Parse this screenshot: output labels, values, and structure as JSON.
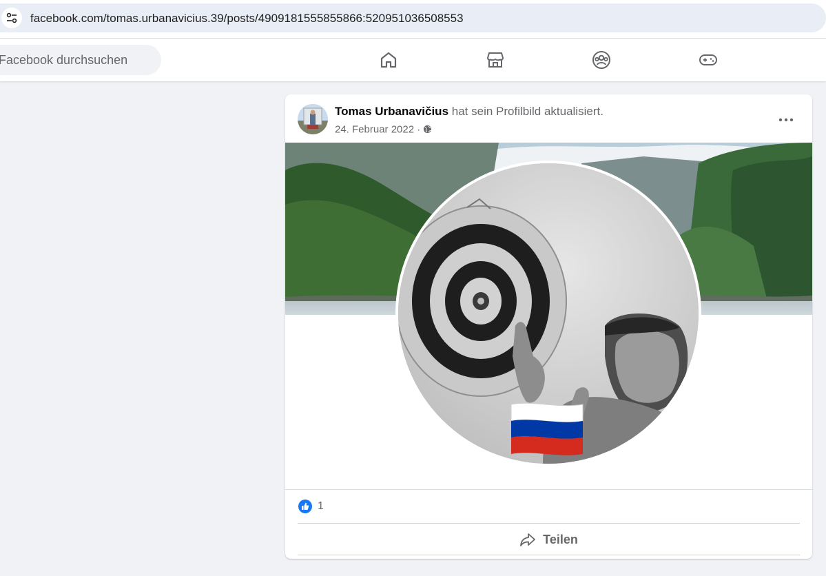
{
  "browser": {
    "url": "facebook.com/tomas.urbanavicius.39/posts/4909181555855866:520951036508553",
    "site_info_icon": "tune-icon"
  },
  "header": {
    "search_placeholder": "Facebook durchsuchen",
    "nav": [
      {
        "name": "home-icon"
      },
      {
        "name": "marketplace-icon"
      },
      {
        "name": "groups-icon"
      },
      {
        "name": "gaming-icon"
      }
    ]
  },
  "post": {
    "author": "Tomas Urbanavičius",
    "action": "hat sein Profilbild aktualisiert.",
    "date": "24. Februar 2022",
    "separator": "·",
    "privacy_icon": "globe-icon",
    "more_icon": "more-dots-icon",
    "like_count": "1",
    "share_label": "Teilen"
  },
  "colors": {
    "facebook_blue": "#1877f2",
    "secondary_text": "#65676b",
    "background": "#f0f2f5"
  }
}
